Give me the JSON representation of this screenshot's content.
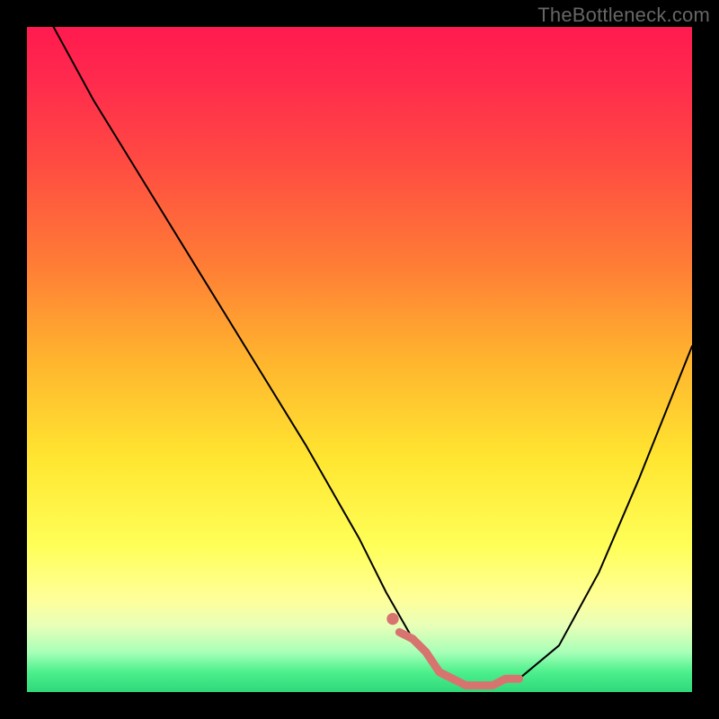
{
  "watermark": "TheBottleneck.com",
  "chart_data": {
    "type": "line",
    "title": "",
    "xlabel": "",
    "ylabel": "",
    "xlim": [
      0,
      100
    ],
    "ylim": [
      0,
      100
    ],
    "grid": false,
    "legend": false,
    "annotations": [],
    "background_gradient": {
      "stops": [
        {
          "pos": 0,
          "color": "#ff1a4f"
        },
        {
          "pos": 50,
          "color": "#ffb42e"
        },
        {
          "pos": 78,
          "color": "#ffff58"
        },
        {
          "pos": 100,
          "color": "#2fd87a"
        }
      ]
    },
    "series": [
      {
        "name": "bottleneck-curve",
        "color": "#000000",
        "stroke_width": 2,
        "x": [
          4,
          10,
          18,
          26,
          34,
          42,
          50,
          54,
          58,
          62,
          66,
          70,
          74,
          80,
          86,
          92,
          100
        ],
        "values": [
          100,
          89,
          76,
          63,
          50,
          37,
          23,
          15,
          8,
          3,
          1,
          1,
          2,
          7,
          18,
          32,
          52
        ]
      },
      {
        "name": "sweet-spot-highlight",
        "color": "#d8746f",
        "stroke_width": 9,
        "x": [
          56,
          58,
          60,
          62,
          64,
          66,
          68,
          70,
          72,
          74
        ],
        "values": [
          9,
          8,
          6,
          3,
          2,
          1,
          1,
          1,
          2,
          2
        ]
      }
    ]
  }
}
